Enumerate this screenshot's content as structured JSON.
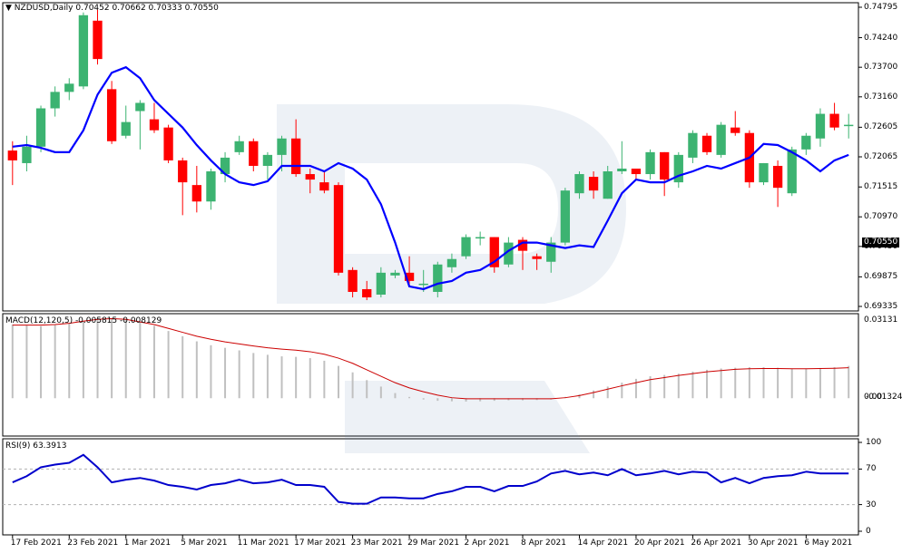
{
  "header": {
    "symbol": "NZDUSD,Daily",
    "ohlc": "0.70452 0.70662 0.70333 0.70550",
    "macd_label": "MACD(12,120,5) -0.005815 -0.008129",
    "rsi_label": "RSI(9) 63.3913"
  },
  "colors": {
    "bull": "#3cb371",
    "bear": "#ff0000",
    "ma_line": "#0000ff",
    "macd_signal": "#cc0000",
    "macd_hist": "#c0c0c0",
    "rsi_line": "#0000cc",
    "grid": "#e6e6e6",
    "axis": "#000000"
  },
  "current_price": "0.70550",
  "x_axis": {
    "labels": [
      "17 Feb 2021",
      "23 Feb 2021",
      "1 Mar 2021",
      "5 Mar 2021",
      "11 Mar 2021",
      "17 Mar 2021",
      "23 Mar 2021",
      "29 Mar 2021",
      "2 Apr 2021",
      "8 Apr 2021",
      "14 Apr 2021",
      "20 Apr 2021",
      "26 Apr 2021",
      "30 Apr 2021",
      "6 May 2021"
    ]
  },
  "chart_data": [
    {
      "type": "candlestick",
      "title": "NZDUSD,Daily",
      "y_ticks": [
        "0.74795",
        "0.74240",
        "0.73700",
        "0.73160",
        "0.72605",
        "0.72065",
        "0.71515",
        "0.70970",
        "0.70430",
        "0.69875",
        "0.69335"
      ],
      "ylim": [
        0.69335,
        0.74795
      ],
      "candles": [
        {
          "o": 0.7218,
          "h": 0.7235,
          "l": 0.7155,
          "c": 0.72
        },
        {
          "o": 0.7195,
          "h": 0.7245,
          "l": 0.718,
          "c": 0.7225
        },
        {
          "o": 0.7225,
          "h": 0.73,
          "l": 0.7215,
          "c": 0.7295
        },
        {
          "o": 0.7295,
          "h": 0.7335,
          "l": 0.728,
          "c": 0.7325
        },
        {
          "o": 0.7325,
          "h": 0.735,
          "l": 0.731,
          "c": 0.734
        },
        {
          "o": 0.7335,
          "h": 0.747,
          "l": 0.733,
          "c": 0.7465
        },
        {
          "o": 0.7455,
          "h": 0.7475,
          "l": 0.7375,
          "c": 0.7385
        },
        {
          "o": 0.733,
          "h": 0.7345,
          "l": 0.723,
          "c": 0.7235
        },
        {
          "o": 0.7245,
          "h": 0.73,
          "l": 0.724,
          "c": 0.727
        },
        {
          "o": 0.729,
          "h": 0.731,
          "l": 0.722,
          "c": 0.7305
        },
        {
          "o": 0.7275,
          "h": 0.7305,
          "l": 0.725,
          "c": 0.7255
        },
        {
          "o": 0.726,
          "h": 0.7265,
          "l": 0.7195,
          "c": 0.72
        },
        {
          "o": 0.72,
          "h": 0.7205,
          "l": 0.71,
          "c": 0.716
        },
        {
          "o": 0.7155,
          "h": 0.719,
          "l": 0.7105,
          "c": 0.7125
        },
        {
          "o": 0.7125,
          "h": 0.7185,
          "l": 0.711,
          "c": 0.718
        },
        {
          "o": 0.7175,
          "h": 0.7215,
          "l": 0.716,
          "c": 0.7205
        },
        {
          "o": 0.7215,
          "h": 0.7245,
          "l": 0.721,
          "c": 0.7235
        },
        {
          "o": 0.7235,
          "h": 0.724,
          "l": 0.718,
          "c": 0.719
        },
        {
          "o": 0.719,
          "h": 0.7215,
          "l": 0.7165,
          "c": 0.721
        },
        {
          "o": 0.721,
          "h": 0.7245,
          "l": 0.718,
          "c": 0.724
        },
        {
          "o": 0.724,
          "h": 0.7275,
          "l": 0.717,
          "c": 0.7175
        },
        {
          "o": 0.7175,
          "h": 0.7185,
          "l": 0.714,
          "c": 0.7165
        },
        {
          "o": 0.716,
          "h": 0.718,
          "l": 0.714,
          "c": 0.7145
        },
        {
          "o": 0.7155,
          "h": 0.716,
          "l": 0.699,
          "c": 0.6995
        },
        {
          "o": 0.7,
          "h": 0.7005,
          "l": 0.695,
          "c": 0.696
        },
        {
          "o": 0.6965,
          "h": 0.698,
          "l": 0.6945,
          "c": 0.695
        },
        {
          "o": 0.6955,
          "h": 0.7005,
          "l": 0.695,
          "c": 0.6995
        },
        {
          "o": 0.699,
          "h": 0.7,
          "l": 0.6985,
          "c": 0.6995
        },
        {
          "o": 0.6995,
          "h": 0.7025,
          "l": 0.697,
          "c": 0.698
        },
        {
          "o": 0.6975,
          "h": 0.7,
          "l": 0.696,
          "c": 0.6975
        },
        {
          "o": 0.696,
          "h": 0.7015,
          "l": 0.695,
          "c": 0.701
        },
        {
          "o": 0.7005,
          "h": 0.703,
          "l": 0.6995,
          "c": 0.702
        },
        {
          "o": 0.7025,
          "h": 0.7065,
          "l": 0.702,
          "c": 0.706
        },
        {
          "o": 0.706,
          "h": 0.707,
          "l": 0.7045,
          "c": 0.706
        },
        {
          "o": 0.706,
          "h": 0.706,
          "l": 0.6995,
          "c": 0.7005
        },
        {
          "o": 0.701,
          "h": 0.706,
          "l": 0.7005,
          "c": 0.705
        },
        {
          "o": 0.7055,
          "h": 0.706,
          "l": 0.7,
          "c": 0.7035
        },
        {
          "o": 0.7025,
          "h": 0.703,
          "l": 0.7,
          "c": 0.702
        },
        {
          "o": 0.7015,
          "h": 0.706,
          "l": 0.6995,
          "c": 0.705
        },
        {
          "o": 0.705,
          "h": 0.715,
          "l": 0.7045,
          "c": 0.7145
        },
        {
          "o": 0.714,
          "h": 0.718,
          "l": 0.713,
          "c": 0.7175
        },
        {
          "o": 0.717,
          "h": 0.718,
          "l": 0.713,
          "c": 0.7145
        },
        {
          "o": 0.713,
          "h": 0.719,
          "l": 0.713,
          "c": 0.718
        },
        {
          "o": 0.718,
          "h": 0.7235,
          "l": 0.7175,
          "c": 0.7185
        },
        {
          "o": 0.7185,
          "h": 0.718,
          "l": 0.7165,
          "c": 0.7175
        },
        {
          "o": 0.7175,
          "h": 0.722,
          "l": 0.7165,
          "c": 0.7215
        },
        {
          "o": 0.7215,
          "h": 0.7215,
          "l": 0.7135,
          "c": 0.7165
        },
        {
          "o": 0.716,
          "h": 0.7215,
          "l": 0.715,
          "c": 0.721
        },
        {
          "o": 0.7205,
          "h": 0.7255,
          "l": 0.7195,
          "c": 0.725
        },
        {
          "o": 0.7245,
          "h": 0.725,
          "l": 0.721,
          "c": 0.7215
        },
        {
          "o": 0.721,
          "h": 0.727,
          "l": 0.7205,
          "c": 0.7265
        },
        {
          "o": 0.726,
          "h": 0.729,
          "l": 0.7245,
          "c": 0.725
        },
        {
          "o": 0.725,
          "h": 0.7255,
          "l": 0.715,
          "c": 0.716
        },
        {
          "o": 0.716,
          "h": 0.7195,
          "l": 0.7155,
          "c": 0.7195
        },
        {
          "o": 0.719,
          "h": 0.72,
          "l": 0.7115,
          "c": 0.715
        },
        {
          "o": 0.714,
          "h": 0.7225,
          "l": 0.7135,
          "c": 0.722
        },
        {
          "o": 0.722,
          "h": 0.725,
          "l": 0.721,
          "c": 0.7245
        },
        {
          "o": 0.724,
          "h": 0.7295,
          "l": 0.7225,
          "c": 0.7285
        },
        {
          "o": 0.7285,
          "h": 0.7305,
          "l": 0.7255,
          "c": 0.726
        },
        {
          "o": 0.7265,
          "h": 0.7285,
          "l": 0.724,
          "c": 0.7265
        }
      ],
      "ma_series": [
        0.7225,
        0.7228,
        0.7223,
        0.7215,
        0.7215,
        0.7255,
        0.732,
        0.736,
        0.737,
        0.735,
        0.731,
        0.7285,
        0.726,
        0.7228,
        0.72,
        0.7175,
        0.716,
        0.7155,
        0.7162,
        0.719,
        0.719,
        0.719,
        0.718,
        0.7195,
        0.7185,
        0.7165,
        0.712,
        0.705,
        0.697,
        0.6965,
        0.6975,
        0.698,
        0.6995,
        0.7,
        0.7015,
        0.7035,
        0.705,
        0.705,
        0.7045,
        0.704,
        0.7045,
        0.7042,
        0.709,
        0.714,
        0.7165,
        0.716,
        0.716,
        0.7172,
        0.718,
        0.719,
        0.7185,
        0.7195,
        0.7205,
        0.723,
        0.7228,
        0.7215,
        0.72,
        0.718,
        0.72,
        0.721
      ]
    },
    {
      "type": "bar",
      "title": "MACD(12,120,5) -0.005815 -0.008129",
      "y_ticks": [
        "0.03131",
        "0.00",
        "-0.01324"
      ],
      "histogram": [
        0.0285,
        0.0282,
        0.0279,
        0.0283,
        0.0288,
        0.0298,
        0.031,
        0.031,
        0.0305,
        0.0295,
        0.028,
        0.026,
        0.024,
        0.022,
        0.0205,
        0.0195,
        0.0185,
        0.0175,
        0.0168,
        0.0162,
        0.016,
        0.0155,
        0.0145,
        0.0125,
        0.01,
        0.007,
        0.0045,
        0.002,
        0.0005,
        -0.0005,
        -0.001,
        -0.0012,
        -0.0013,
        -0.0012,
        -0.001,
        -0.0008,
        -0.0008,
        -0.0007,
        -0.0005,
        0.0005,
        0.0015,
        0.003,
        0.0045,
        0.006,
        0.0075,
        0.0085,
        0.009,
        0.0095,
        0.0103,
        0.011,
        0.0115,
        0.0118,
        0.012,
        0.012,
        0.0118,
        0.0115,
        0.0115,
        0.0117,
        0.012,
        0.0125
      ],
      "signal": [
        0.0283,
        0.0283,
        0.0283,
        0.0285,
        0.029,
        0.0298,
        0.0305,
        0.0308,
        0.0305,
        0.0295,
        0.0285,
        0.027,
        0.0255,
        0.024,
        0.0228,
        0.0218,
        0.021,
        0.0202,
        0.0195,
        0.019,
        0.0186,
        0.018,
        0.017,
        0.0155,
        0.0135,
        0.011,
        0.0085,
        0.006,
        0.004,
        0.0025,
        0.0012,
        0.0002,
        -0.0002,
        -0.0002,
        -0.0002,
        -0.0002,
        -0.0002,
        -0.0002,
        -0.0002,
        0.0002,
        0.001,
        0.0022,
        0.0035,
        0.0048,
        0.006,
        0.0072,
        0.008,
        0.0088,
        0.0095,
        0.0102,
        0.0107,
        0.0112,
        0.0114,
        0.0115,
        0.0115,
        0.0114,
        0.0114,
        0.0115,
        0.0116,
        0.0118
      ]
    },
    {
      "type": "line",
      "title": "RSI(9) 63.3913",
      "y_ticks": [
        "100",
        "70",
        "30",
        "0"
      ],
      "ylim": [
        0,
        100
      ],
      "values": [
        55,
        62,
        72,
        75,
        77,
        86,
        72,
        55,
        58,
        60,
        57,
        52,
        50,
        47,
        52,
        54,
        58,
        54,
        55,
        58,
        52,
        52,
        50,
        33,
        31,
        31,
        38,
        38,
        37,
        37,
        42,
        45,
        50,
        50,
        45,
        51,
        51,
        56,
        65,
        68,
        64,
        66,
        63,
        70,
        63,
        65,
        68,
        64,
        67,
        66,
        55,
        60,
        54,
        60,
        62,
        63,
        67,
        65,
        65,
        65
      ]
    }
  ]
}
